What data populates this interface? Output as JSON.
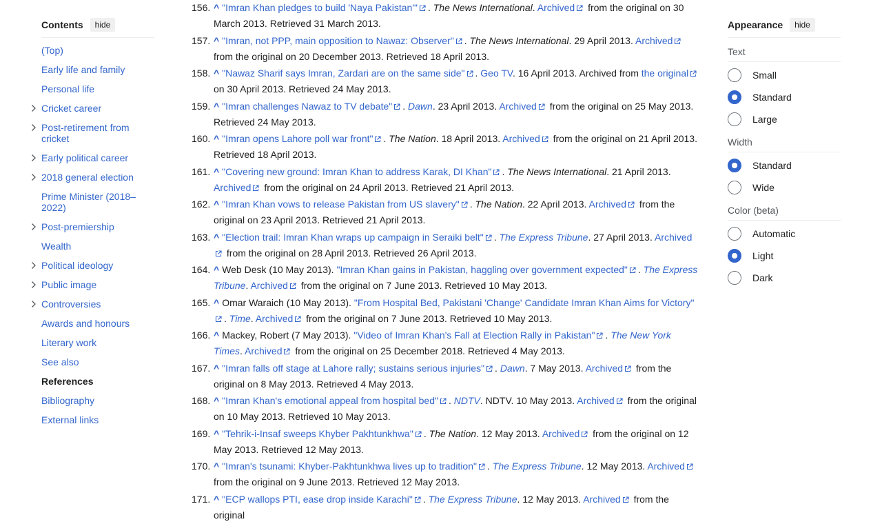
{
  "toc": {
    "title": "Contents",
    "hide_label": "hide",
    "items": [
      {
        "label": "(Top)",
        "expandable": false
      },
      {
        "label": "Early life and family",
        "expandable": false
      },
      {
        "label": "Personal life",
        "expandable": false
      },
      {
        "label": "Cricket career",
        "expandable": true
      },
      {
        "label": "Post-retirement from cricket",
        "expandable": true
      },
      {
        "label": "Early political career",
        "expandable": true
      },
      {
        "label": "2018 general election",
        "expandable": true
      },
      {
        "label": "Prime Minister (2018–2022)",
        "expandable": false
      },
      {
        "label": "Post-premiership",
        "expandable": true
      },
      {
        "label": "Wealth",
        "expandable": false
      },
      {
        "label": "Political ideology",
        "expandable": true
      },
      {
        "label": "Public image",
        "expandable": true
      },
      {
        "label": "Controversies",
        "expandable": true
      },
      {
        "label": "Awards and honours",
        "expandable": false
      },
      {
        "label": "Literary work",
        "expandable": false
      },
      {
        "label": "See also",
        "expandable": false
      },
      {
        "label": "References",
        "expandable": false,
        "current": true
      },
      {
        "label": "Bibliography",
        "expandable": false
      },
      {
        "label": "External links",
        "expandable": false
      }
    ]
  },
  "appearance": {
    "title": "Appearance",
    "hide_label": "hide",
    "text": {
      "label": "Text",
      "options": [
        "Small",
        "Standard",
        "Large"
      ],
      "selected": "Standard"
    },
    "width": {
      "label": "Width",
      "options": [
        "Standard",
        "Wide"
      ],
      "selected": "Standard"
    },
    "color": {
      "label": "Color (beta)",
      "options": [
        "Automatic",
        "Light",
        "Dark"
      ],
      "selected": "Light"
    }
  },
  "references": [
    {
      "num": "156.",
      "parts": [
        [
          "link",
          "\"Imran Khan pledges to build 'Naya Pakistan'\"",
          true
        ],
        [
          "t",
          ". "
        ],
        [
          "i",
          "The News International"
        ],
        [
          "t",
          ". "
        ],
        [
          "link",
          "Archived",
          true
        ],
        [
          "t",
          " from the original on 30 March 2013. Retrieved 31 March 2013."
        ]
      ]
    },
    {
      "num": "157.",
      "parts": [
        [
          "link",
          "\"Imran, not PPP, main opposition to Nawaz: Observer\"",
          true
        ],
        [
          "t",
          ". "
        ],
        [
          "i",
          "The News International"
        ],
        [
          "t",
          ". 29 April 2013. "
        ],
        [
          "link",
          "Archived",
          true
        ],
        [
          "t",
          " from the original on 20 December 2013. Retrieved 18 April 2013."
        ]
      ]
    },
    {
      "num": "158.",
      "parts": [
        [
          "link",
          "\"Nawaz Sharif says Imran, Zardari are on the same side\"",
          true
        ],
        [
          "t",
          ". "
        ],
        [
          "link",
          "Geo TV",
          false
        ],
        [
          "t",
          ". 16 April 2013. Archived from "
        ],
        [
          "link",
          "the original",
          true
        ],
        [
          "t",
          " on 30 April 2013. Retrieved 24 May 2013."
        ]
      ]
    },
    {
      "num": "159.",
      "parts": [
        [
          "link",
          "\"Imran challenges Nawaz to TV debate\"",
          true
        ],
        [
          "t",
          ". "
        ],
        [
          "ilink",
          "Dawn"
        ],
        [
          "t",
          ". 23 April 2013. "
        ],
        [
          "link",
          "Archived",
          true
        ],
        [
          "t",
          " from the original on 25 May 2013. Retrieved 24 May 2013."
        ]
      ]
    },
    {
      "num": "160.",
      "parts": [
        [
          "link",
          "\"Imran opens Lahore poll war front\"",
          true
        ],
        [
          "t",
          ". "
        ],
        [
          "i",
          "The Nation"
        ],
        [
          "t",
          ". 18 April 2013. "
        ],
        [
          "link",
          "Archived",
          true
        ],
        [
          "t",
          " from the original on 21 April 2013. Retrieved 18 April 2013."
        ]
      ]
    },
    {
      "num": "161.",
      "parts": [
        [
          "link",
          "\"Covering new ground: Imran Khan to address Karak, DI Khan\"",
          true
        ],
        [
          "t",
          ". "
        ],
        [
          "i",
          "The News International"
        ],
        [
          "t",
          ". 21 April 2013. "
        ],
        [
          "link",
          "Archived",
          true
        ],
        [
          "t",
          " from the original on 24 April 2013. Retrieved 21 April 2013."
        ]
      ]
    },
    {
      "num": "162.",
      "parts": [
        [
          "link",
          "\"Imran Khan vows to release Pakistan from US slavery\"",
          true
        ],
        [
          "t",
          ". "
        ],
        [
          "i",
          "The Nation"
        ],
        [
          "t",
          ". 22 April 2013. "
        ],
        [
          "link",
          "Archived",
          true
        ],
        [
          "t",
          " from the original on 23 April 2013. Retrieved 21 April 2013."
        ]
      ]
    },
    {
      "num": "163.",
      "parts": [
        [
          "link",
          "\"Election trail: Imran Khan wraps up campaign in Seraiki belt\"",
          true
        ],
        [
          "t",
          ". "
        ],
        [
          "ilink",
          "The Express Tribune"
        ],
        [
          "t",
          ". 27 April 2013. "
        ],
        [
          "link",
          "Archived",
          true
        ],
        [
          "t",
          " from the original on 28 April 2013. Retrieved 26 April 2013."
        ]
      ]
    },
    {
      "num": "164.",
      "parts": [
        [
          "t",
          "Web Desk (10 May 2013). "
        ],
        [
          "link",
          "\"Imran Khan gains in Pakistan, haggling over government expected\"",
          true
        ],
        [
          "t",
          ". "
        ],
        [
          "ilink",
          "The Express Tribune"
        ],
        [
          "t",
          ". "
        ],
        [
          "link",
          "Archived",
          true
        ],
        [
          "t",
          " from the original on 7 June 2013. Retrieved 10 May 2013."
        ]
      ]
    },
    {
      "num": "165.",
      "parts": [
        [
          "t",
          "Omar Waraich (10 May 2013). "
        ],
        [
          "link",
          "\"From Hospital Bed, Pakistani 'Change' Candidate Imran Khan Aims for Victory\"",
          true
        ],
        [
          "t",
          ". "
        ],
        [
          "ilink",
          "Time"
        ],
        [
          "t",
          ". "
        ],
        [
          "link",
          "Archived",
          true
        ],
        [
          "t",
          " from the original on 7 June 2013. Retrieved 10 May 2013."
        ]
      ]
    },
    {
      "num": "166.",
      "parts": [
        [
          "t",
          "Mackey, Robert (7 May 2013). "
        ],
        [
          "link",
          "\"Video of Imran Khan's Fall at Election Rally in Pakistan\"",
          true
        ],
        [
          "t",
          ". "
        ],
        [
          "ilink",
          "The New York Times"
        ],
        [
          "t",
          ". "
        ],
        [
          "link",
          "Archived",
          true
        ],
        [
          "t",
          " from the original on 25 December 2018. Retrieved 4 May 2013."
        ]
      ]
    },
    {
      "num": "167.",
      "parts": [
        [
          "link",
          "\"Imran falls off stage at Lahore rally; sustains serious injuries\"",
          true
        ],
        [
          "t",
          ". "
        ],
        [
          "ilink",
          "Dawn"
        ],
        [
          "t",
          ". 7 May 2013. "
        ],
        [
          "link",
          "Archived",
          true
        ],
        [
          "t",
          " from the original on 8 May 2013. Retrieved 4 May 2013."
        ]
      ]
    },
    {
      "num": "168.",
      "parts": [
        [
          "link",
          "\"Imran Khan's emotional appeal from hospital bed\"",
          true
        ],
        [
          "t",
          ". "
        ],
        [
          "ilink",
          "NDTV"
        ],
        [
          "t",
          ". NDTV. 10 May 2013. "
        ],
        [
          "link",
          "Archived",
          true
        ],
        [
          "t",
          " from the original on 10 May 2013. Retrieved 10 May 2013."
        ]
      ]
    },
    {
      "num": "169.",
      "parts": [
        [
          "link",
          "\"Tehrik-i-Insaf sweeps Khyber Pakhtunkhwa\"",
          true
        ],
        [
          "t",
          ". "
        ],
        [
          "i",
          "The Nation"
        ],
        [
          "t",
          ". 12 May 2013. "
        ],
        [
          "link",
          "Archived",
          true
        ],
        [
          "t",
          " from the original on 12 May 2013. Retrieved 12 May 2013."
        ]
      ]
    },
    {
      "num": "170.",
      "parts": [
        [
          "link",
          "\"Imran's tsunami: Khyber-Pakhtunkhwa lives up to tradition\"",
          true
        ],
        [
          "t",
          ". "
        ],
        [
          "ilink",
          "The Express Tribune"
        ],
        [
          "t",
          ". 12 May 2013. "
        ],
        [
          "link",
          "Archived",
          true
        ],
        [
          "t",
          " from the original on 9 June 2013. Retrieved 12 May 2013."
        ]
      ]
    },
    {
      "num": "171.",
      "parts": [
        [
          "link",
          "\"ECP wallops PTI, ease drop inside Karachi\"",
          true
        ],
        [
          "t",
          ". "
        ],
        [
          "ilink",
          "The Express Tribune"
        ],
        [
          "t",
          ". 12 May 2013. "
        ],
        [
          "link",
          "Archived",
          true
        ],
        [
          "t",
          " from the original"
        ]
      ]
    }
  ],
  "colors": {
    "link": "#3366cc",
    "text": "#202122",
    "radio_on": "#3366cc"
  }
}
